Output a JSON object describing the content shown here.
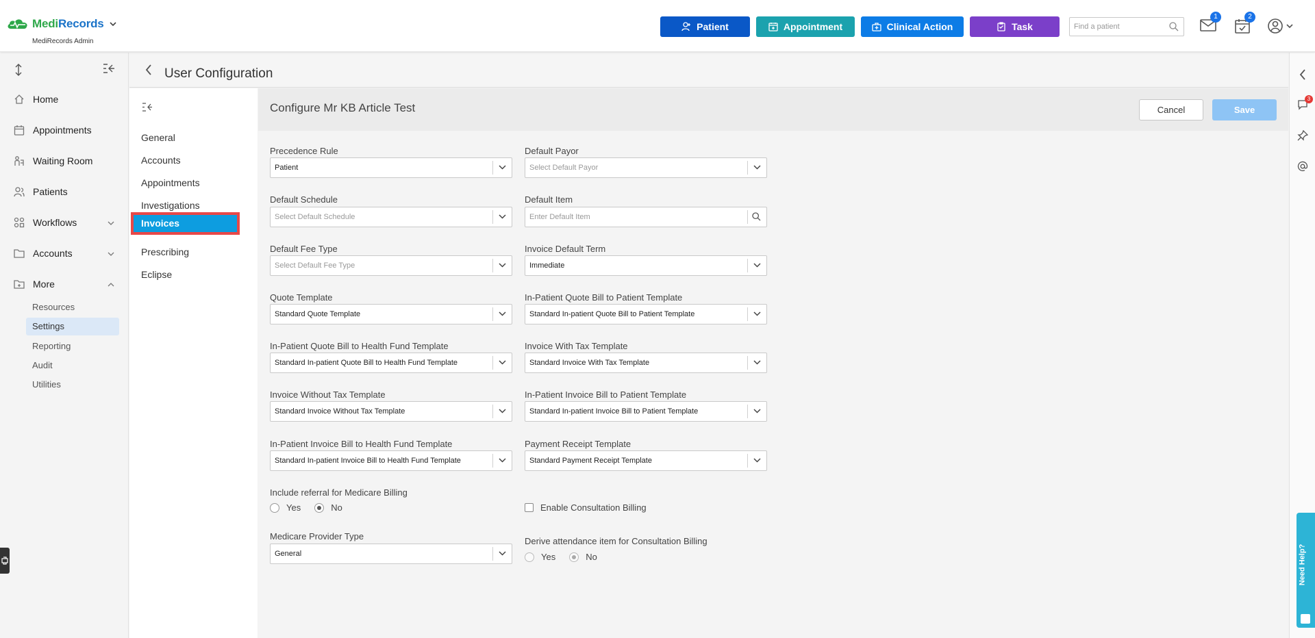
{
  "app": {
    "brand_medi": "Medi",
    "brand_records": "Records",
    "subtitle": "MediRecords Admin"
  },
  "header": {
    "buttons": [
      {
        "label": "Patient",
        "color": "#0a58c7"
      },
      {
        "label": "Appointment",
        "color": "#1ba2ae"
      },
      {
        "label": "Clinical Action",
        "color": "#0d7ce6"
      },
      {
        "label": "Task",
        "color": "#7b3fc9"
      }
    ],
    "search_placeholder": "Find a patient",
    "mail_badge": "1",
    "tasks_badge": "2"
  },
  "sidebar": {
    "items": [
      {
        "label": "Home",
        "icon": "home-icon"
      },
      {
        "label": "Appointments",
        "icon": "calendar-icon"
      },
      {
        "label": "Waiting Room",
        "icon": "waiting-room-icon"
      },
      {
        "label": "Patients",
        "icon": "patients-icon"
      },
      {
        "label": "Workflows",
        "icon": "workflows-icon"
      },
      {
        "label": "Accounts",
        "icon": "folder-icon"
      },
      {
        "label": "More",
        "icon": "more-icon"
      }
    ],
    "sub_items": [
      "Resources",
      "Settings",
      "Reporting",
      "Audit",
      "Utilities"
    ],
    "active_sub": "Settings"
  },
  "page": {
    "title": "User Configuration"
  },
  "config_nav": {
    "items": [
      "General",
      "Accounts",
      "Appointments",
      "Investigations",
      "Invoices",
      "Prescribing",
      "Eclipse"
    ],
    "active": "Invoices"
  },
  "form": {
    "title": "Configure Mr KB Article Test",
    "cancel_label": "Cancel",
    "save_label": "Save",
    "fields": {
      "precedence_rule": {
        "label": "Precedence Rule",
        "value": "Patient"
      },
      "default_payor": {
        "label": "Default Payor",
        "placeholder": "Select Default Payor"
      },
      "default_schedule": {
        "label": "Default Schedule",
        "placeholder": "Select Default Schedule"
      },
      "default_item": {
        "label": "Default Item",
        "placeholder": "Enter Default Item"
      },
      "default_fee_type": {
        "label": "Default Fee Type",
        "placeholder": "Select Default Fee Type"
      },
      "invoice_default_term": {
        "label": "Invoice Default Term",
        "value": "Immediate"
      },
      "quote_template": {
        "label": "Quote Template",
        "value": "Standard Quote Template"
      },
      "inpatient_quote_patient": {
        "label": "In-Patient Quote Bill to Patient Template",
        "value": "Standard In-patient Quote Bill to Patient Template"
      },
      "inpatient_quote_fund": {
        "label": "In-Patient Quote Bill to Health Fund Template",
        "value": "Standard In-patient Quote Bill to Health Fund Template"
      },
      "invoice_with_tax": {
        "label": "Invoice With Tax Template",
        "value": "Standard Invoice With Tax Template"
      },
      "invoice_without_tax": {
        "label": "Invoice Without Tax Template",
        "value": "Standard Invoice Without Tax Template"
      },
      "inpatient_invoice_patient": {
        "label": "In-Patient Invoice Bill to Patient Template",
        "value": "Standard In-patient Invoice Bill to Patient Template"
      },
      "inpatient_invoice_fund": {
        "label": "In-Patient Invoice Bill to Health Fund Template",
        "value": "Standard In-patient Invoice Bill to Health Fund Template"
      },
      "payment_receipt": {
        "label": "Payment Receipt Template",
        "value": "Standard Payment Receipt Template"
      },
      "include_referral": {
        "label": "Include referral for Medicare Billing",
        "options": [
          "Yes",
          "No"
        ],
        "selected": "No"
      },
      "enable_consultation": {
        "label": "Enable Consultation Billing",
        "checked": false
      },
      "medicare_provider_type": {
        "label": "Medicare Provider Type",
        "value": "General"
      },
      "derive_attendance": {
        "label": "Derive attendance item for Consultation Billing",
        "options": [
          "Yes",
          "No"
        ],
        "selected": "No"
      }
    }
  },
  "right_rail": {
    "notifications_badge": "3",
    "help_label": "Need Help?"
  }
}
